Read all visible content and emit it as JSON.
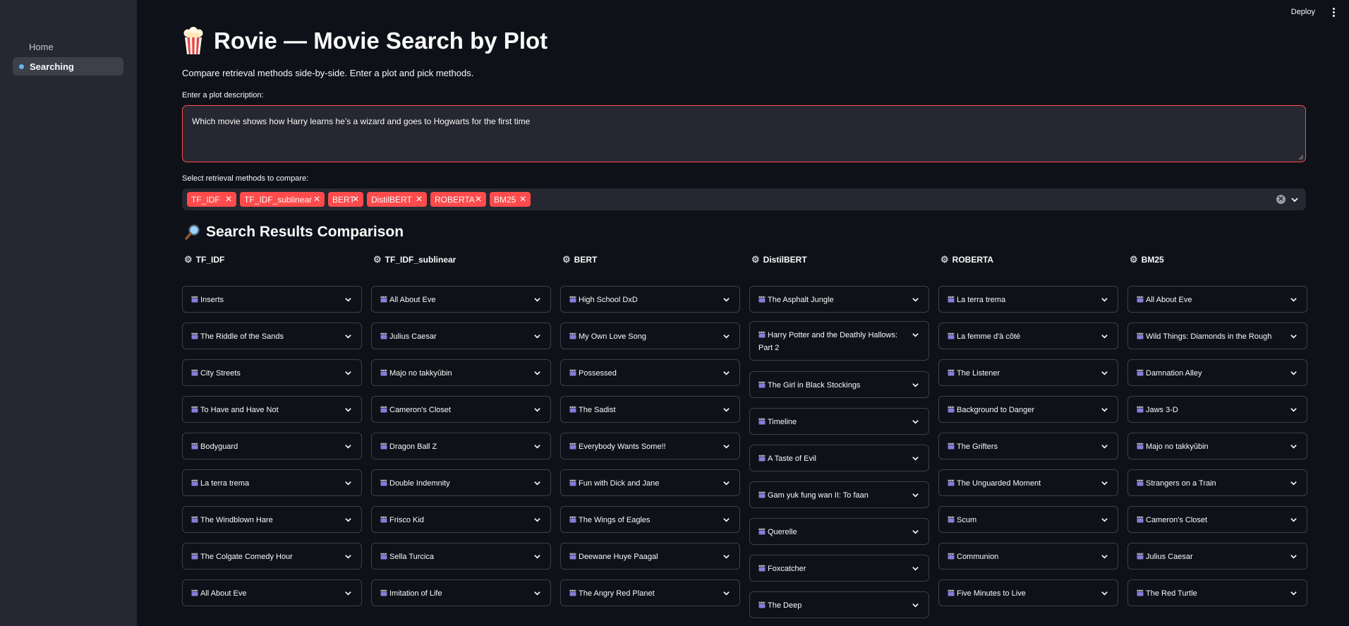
{
  "sidebar": {
    "items": [
      {
        "label": "Home",
        "active": false
      },
      {
        "label": "Searching",
        "active": true
      }
    ]
  },
  "header": {
    "deploy_label": "Deploy"
  },
  "page": {
    "title": "Rovie — Movie Search by Plot",
    "subtitle": "Compare retrieval methods side-by-side. Enter a plot and pick methods.",
    "plot_label": "Enter a plot description:",
    "plot_value": "Which movie shows how Harry learns he’s a wizard and goes to Hogwarts for the first time",
    "methods_label": "Select retrieval methods to compare:",
    "methods": [
      "TF_IDF",
      "TF_IDF_sublinear",
      "BERT",
      "DistilBERT",
      "ROBERTA",
      "BM25"
    ],
    "results_title": "Search Results Comparison"
  },
  "colors": {
    "accent": "#ff4b4b",
    "background": "#0e1117",
    "sidebar": "#262730",
    "border": "#3d3f4b"
  },
  "results": [
    {
      "method": "TF_IDF",
      "movies": [
        "Inserts",
        "The Riddle of the Sands",
        "City Streets",
        "To Have and Have Not",
        "Bodyguard",
        "La terra trema",
        "The Windblown Hare",
        "The Colgate Comedy Hour",
        "All About Eve"
      ]
    },
    {
      "method": "TF_IDF_sublinear",
      "movies": [
        "All About Eve",
        "Julius Caesar",
        "Majo no takkyûbin",
        "Cameron's Closet",
        "Dragon Ball Z",
        "Double Indemnity",
        "Frisco Kid",
        "Sella Turcica",
        "Imitation of Life"
      ]
    },
    {
      "method": "BERT",
      "movies": [
        "High School DxD",
        "My Own Love Song",
        "Possessed",
        "The Sadist",
        "Everybody Wants Some!!",
        "Fun with Dick and Jane",
        "The Wings of Eagles",
        "Deewane Huye Paagal",
        "The Angry Red Planet"
      ]
    },
    {
      "method": "DistilBERT",
      "movies": [
        "The Asphalt Jungle",
        "Harry Potter and the Deathly Hallows: Part 2",
        "The Girl in Black Stockings",
        "Timeline",
        "A Taste of Evil",
        "Gam yuk fung wan II: To faan",
        "Querelle",
        "Foxcatcher",
        "The Deep"
      ]
    },
    {
      "method": "ROBERTA",
      "movies": [
        "La terra trema",
        "La femme d'à côté",
        "The Listener",
        "Background to Danger",
        "The Grifters",
        "The Unguarded Moment",
        "Scum",
        "Communion",
        "Five Minutes to Live"
      ]
    },
    {
      "method": "BM25",
      "movies": [
        "All About Eve",
        "Wild Things: Diamonds in the Rough",
        "Damnation Alley",
        "Jaws 3-D",
        "Majo no takkyûbin",
        "Strangers on a Train",
        "Cameron's Closet",
        "Julius Caesar",
        "The Red Turtle"
      ]
    }
  ]
}
